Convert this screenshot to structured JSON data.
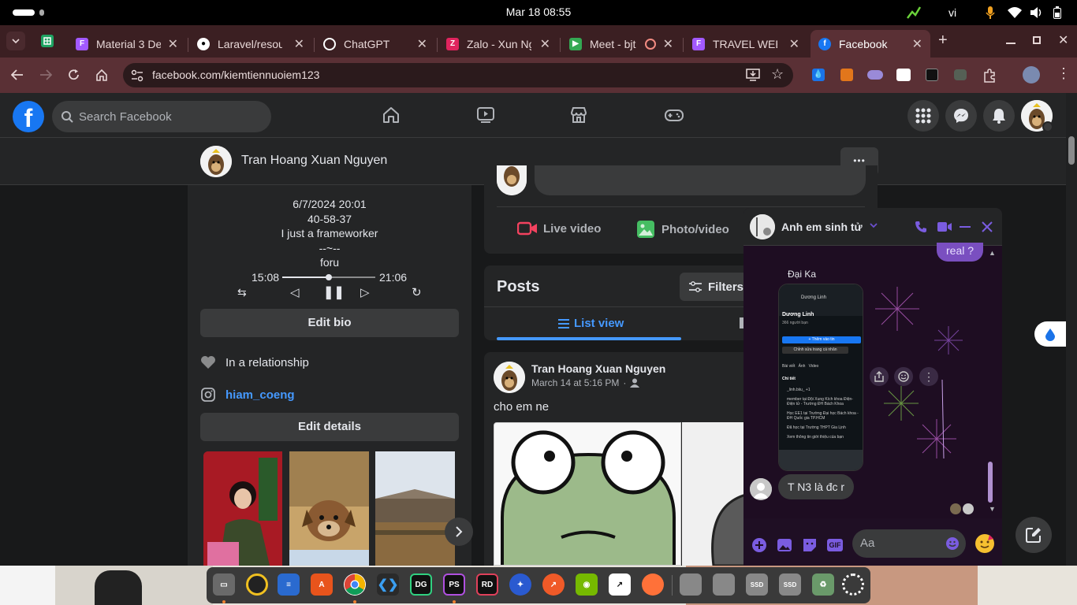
{
  "system": {
    "datetime": "Mar 18  08:55",
    "lang": "vi"
  },
  "tabs": [
    {
      "title": "Material 3 De",
      "icon": "figma-icon",
      "color": "#a259ff"
    },
    {
      "title": "Laravel/resou",
      "icon": "github-icon",
      "color": "#ffffff"
    },
    {
      "title": "ChatGPT",
      "icon": "chatgpt-icon",
      "color": "#ffffff"
    },
    {
      "title": "Zalo - Xun Ng",
      "icon": "zalo-icon",
      "color": "#e0245e"
    },
    {
      "title": "Meet - bjt",
      "icon": "meet-icon",
      "color": "#34a853"
    },
    {
      "title": "TRAVEL WEB",
      "icon": "figma-icon",
      "color": "#a259ff"
    },
    {
      "title": "Facebook",
      "icon": "facebook-icon",
      "color": "#1877f2"
    }
  ],
  "address": {
    "url": "facebook.com/kiemtiennuoiem123"
  },
  "fb": {
    "logo": "f",
    "search_placeholder": "Search Facebook"
  },
  "profile": {
    "name": "Tran Hoang Xuan Nguyen",
    "more": "•••"
  },
  "intro": {
    "lines": [
      "6/7/2024 20:01",
      "40-58-37",
      "I just a frameworker",
      "--~--",
      "foru"
    ],
    "time_start": "15:08",
    "time_end": "21:06",
    "player_progress": 0.5,
    "edit_bio": "Edit bio",
    "relationship": "In a relationship",
    "instagram": "hiam_coeng",
    "edit_details": "Edit details"
  },
  "composer": {
    "live_video": "Live video",
    "photo_video": "Photo/video"
  },
  "posts": {
    "title": "Posts",
    "filters": "Filters",
    "list_view": "List view"
  },
  "post": {
    "author": "Tran Hoang Xuan Nguyen",
    "date": "March 14 at 5:16 PM",
    "dot": "·",
    "text": "cho em ne"
  },
  "chat": {
    "name": "Anh em sinh tử",
    "prev_bubble": "real ?",
    "sender": "Đại Ka",
    "message": "T N3 là đc r",
    "input_placeholder": "Aa",
    "shot": {
      "name": "Dương Linh",
      "friends": "366 người bạn",
      "add_story": "+ Thêm vào tin",
      "edit_profile": "Chỉnh sửa trang cá nhân",
      "tabs": "Bài viết   Ảnh   Video",
      "details": "Chi tiết",
      "lines": [
        "_linh.biiu_ +1",
        "member tại Đội Xung Kích khoa Điện-Điện tử - Trường ĐH Bách Khoa",
        "Học EE1 tại Trường Đại học Bách khoa - ĐH Quốc gia TP.HCM",
        "Đã học tại Trường THPT Gia Lịnh",
        "Xem thông tin giới thiệu của bạn"
      ]
    }
  }
}
